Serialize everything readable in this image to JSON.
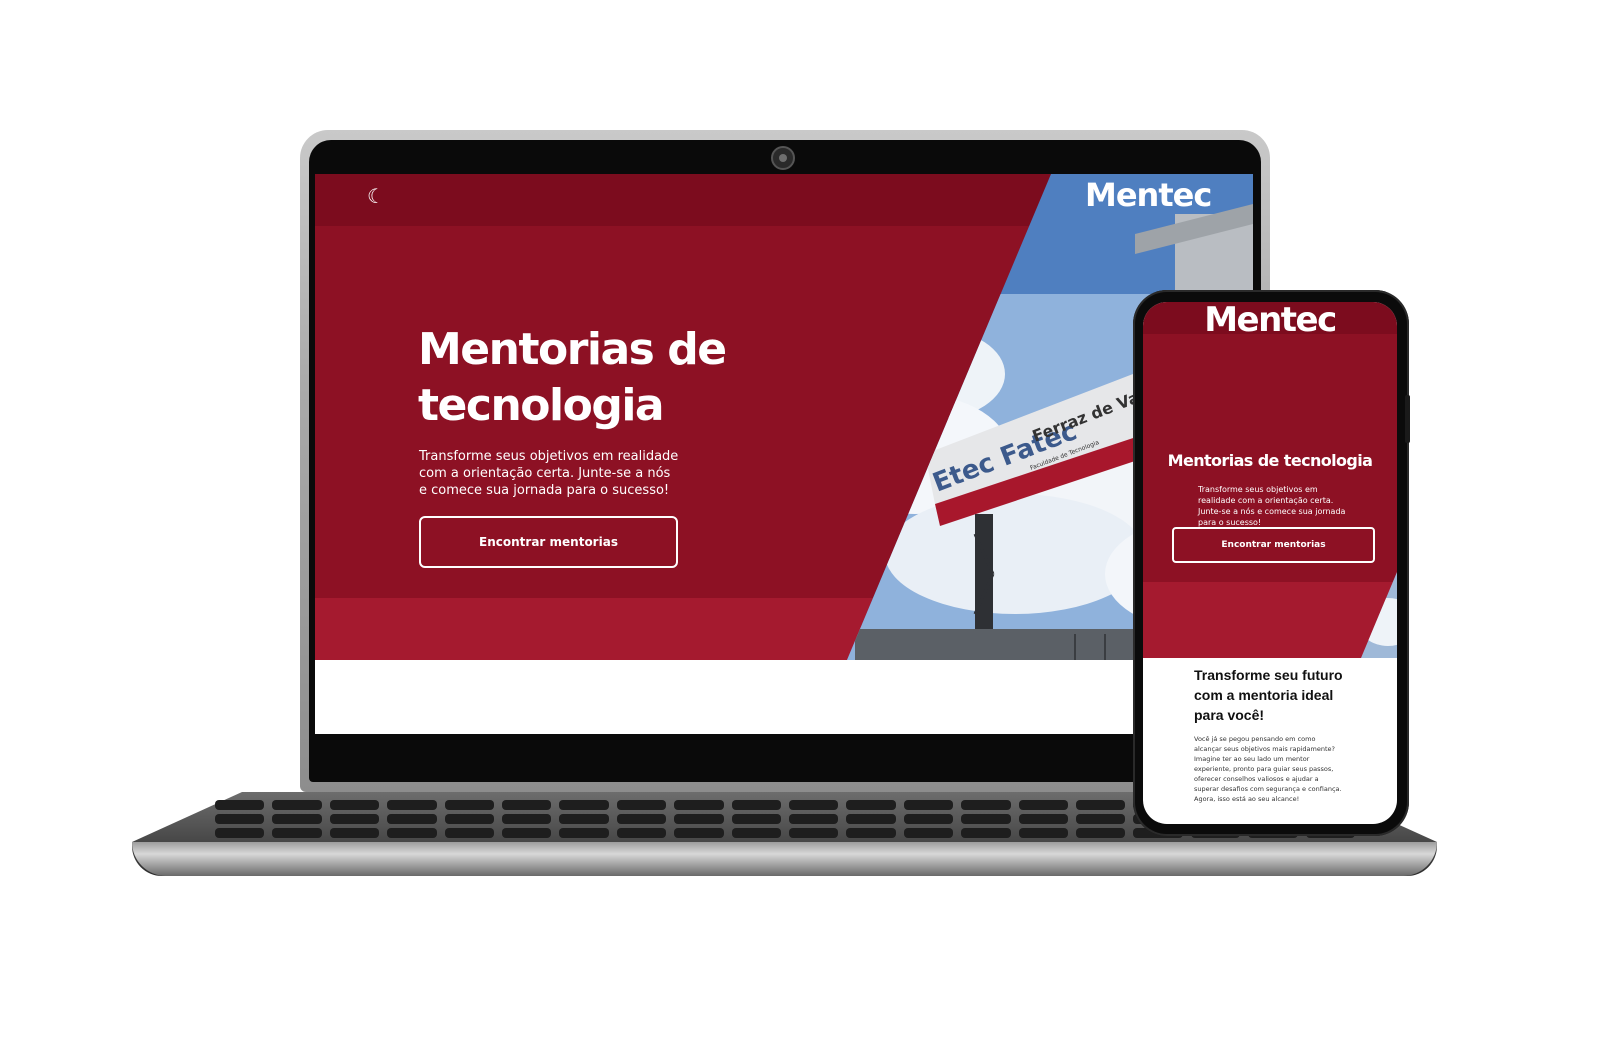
{
  "laptop": {
    "header": {
      "theme_toggle_icon": "moon-icon",
      "logo": "Mentec"
    },
    "hero": {
      "title": "Mentorias de tecnologia",
      "subtitle": "Transforme seus objetivos em realidade com a orientação certa. Junte-se a nós e comece sua jornada para o sucesso!",
      "cta_label": "Encontrar mentorias"
    },
    "photo": {
      "sign_main": "Etec Fatec",
      "sign_secondary": "Ferraz de Vasc",
      "sign_caption": "Faculdade de Tecnologia"
    }
  },
  "phone": {
    "header": {
      "logo": "Mentec"
    },
    "hero": {
      "title": "Mentorias de tecnologia",
      "subtitle": "Transforme seus objetivos em realidade com a orientação certa. Junte-se a nós e comece sua jornada para o sucesso!",
      "cta_label": "Encontrar mentorias"
    },
    "section": {
      "heading": "Transforme seu futuro com a mentoria ideal para você!",
      "body": "Você já se pegou pensando em como alcançar seus objetivos mais rapidamente? Imagine ter ao seu lado um mentor experiente, pronto para guiar seus passos, oferecer conselhos valiosos e ajudar a superar desafios com segurança e confiança. Agora, isso está ao seu alcance!"
    }
  },
  "colors": {
    "header_dark_red": "#7c0c1e",
    "hero_red": "#8d1124",
    "hero_bottom_red": "#a51a2f",
    "text_white": "#ffffff"
  }
}
